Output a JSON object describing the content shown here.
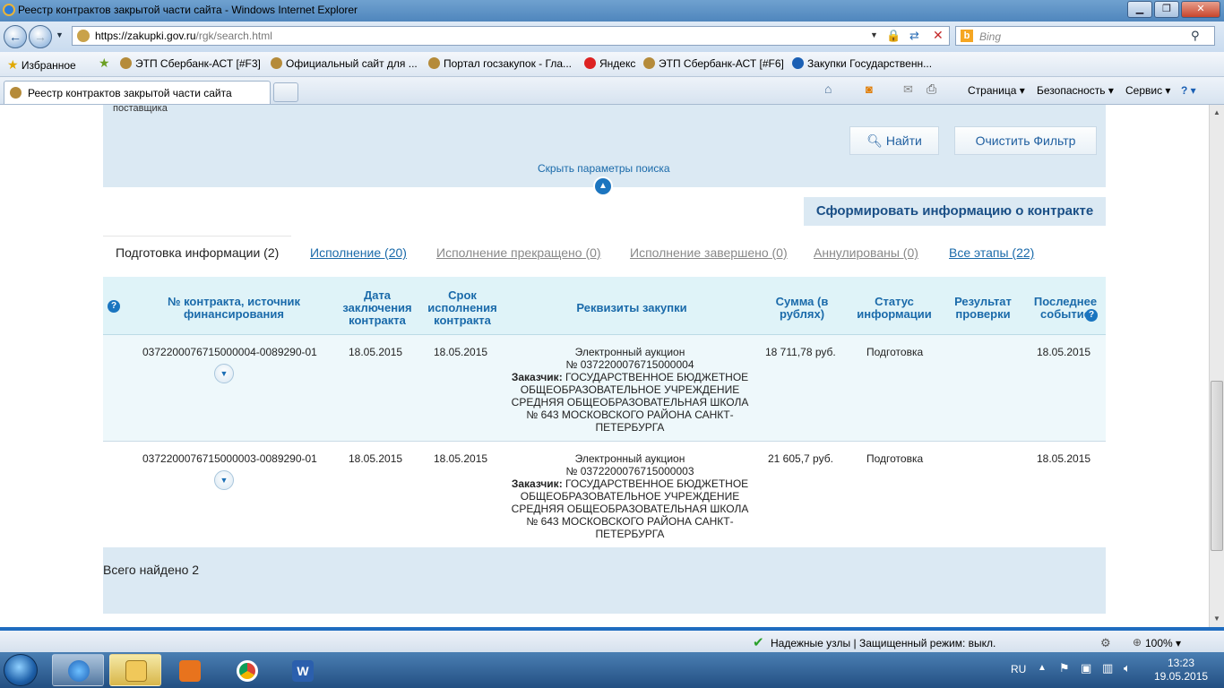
{
  "window": {
    "title": "Реестр контрактов закрытой части сайта - Windows Internet Explorer",
    "minimize": "▁",
    "maximize": "❐",
    "close": "✕"
  },
  "address_bar": {
    "url_host": "https://zakupki.gov.ru",
    "url_path": "/rgk/search.html",
    "search_placeholder": "Bing"
  },
  "favorites_bar": {
    "favorites_label": "Избранное",
    "links": [
      "ЭТП Сбербанк-АСТ [#F3]",
      "Официальный сайт для ...",
      "Портал госзакупок - Гла...",
      "Яндекс",
      "ЭТП Сбербанк-АСТ [#F6]",
      "Закупки  Государственн..."
    ]
  },
  "command_bar": {
    "tab_title": "Реестр контрактов закрытой части сайта",
    "page": "Страница ▾",
    "safety": "Безопасность ▾",
    "tools": "Сервис ▾",
    "help": "? ▾"
  },
  "search_panel": {
    "supplier_text": "поставщика",
    "find_button": "Найти",
    "clear_button": "Очистить Фильтр",
    "hide_params_link": "Скрыть параметры поиска"
  },
  "form_contract_button": "Сформировать информацию о контракте",
  "tabs": [
    {
      "label": "Подготовка информации (2)"
    },
    {
      "label": "Исполнение (20)"
    },
    {
      "label": "Исполнение прекращено (0)"
    },
    {
      "label": "Исполнение завершено (0)"
    },
    {
      "label": "Аннулированы (0)"
    },
    {
      "label": "Все этапы (22)"
    }
  ],
  "table": {
    "headers": {
      "number": "№ контракта, источник финансирования",
      "date": "Дата заключения контракта",
      "term": "Срок исполнения контракта",
      "requisites": "Реквизиты закупки",
      "sum": "Сумма (в рублях)",
      "status": "Статус информации",
      "result": "Результат проверки",
      "last_event": "Последнее событие"
    },
    "rows": [
      {
        "number": "0372200076715000004-0089290-01",
        "date": "18.05.2015",
        "term": "18.05.2015",
        "auction_type": "Электронный аукцион",
        "auction_no": "№ 0372200076715000004",
        "customer_label": "Заказчик:",
        "customer": "ГОСУДАРСТВЕННОЕ БЮДЖЕТНОЕ ОБЩЕОБРАЗОВАТЕЛЬНОЕ УЧРЕЖДЕНИЕ СРЕДНЯЯ ОБЩЕОБРАЗОВАТЕЛЬНАЯ ШКОЛА № 643 МОСКОВСКОГО РАЙОНА САНКТ-ПЕТЕРБУРГА",
        "sum": "18 711,78 руб.",
        "status": "Подготовка",
        "result": "",
        "last_event": "18.05.2015"
      },
      {
        "number": "0372200076715000003-0089290-01",
        "date": "18.05.2015",
        "term": "18.05.2015",
        "auction_type": "Электронный аукцион",
        "auction_no": "№ 0372200076715000003",
        "customer_label": "Заказчик:",
        "customer": "ГОСУДАРСТВЕННОЕ БЮДЖЕТНОЕ ОБЩЕОБРАЗОВАТЕЛЬНОЕ УЧРЕЖДЕНИЕ СРЕДНЯЯ ОБЩЕОБРАЗОВАТЕЛЬНАЯ ШКОЛА № 643 МОСКОВСКОГО РАЙОНА САНКТ-ПЕТЕРБУРГА",
        "sum": "21 605,7 руб.",
        "status": "Подготовка",
        "result": "",
        "last_event": "18.05.2015"
      }
    ]
  },
  "total_found": "Всего найдено 2",
  "status_bar": {
    "zone": "Надежные узлы | Защищенный режим: выкл.",
    "zoom": "100% ▾"
  },
  "taskbar": {
    "language": "RU",
    "time": "13:23",
    "date": "19.05.2015"
  },
  "colors": {
    "accent_blue": "#1a6aaa",
    "panel_bg": "#dbe9f3",
    "header_bg": "#dff3f8",
    "taskbar": "#234f82"
  }
}
